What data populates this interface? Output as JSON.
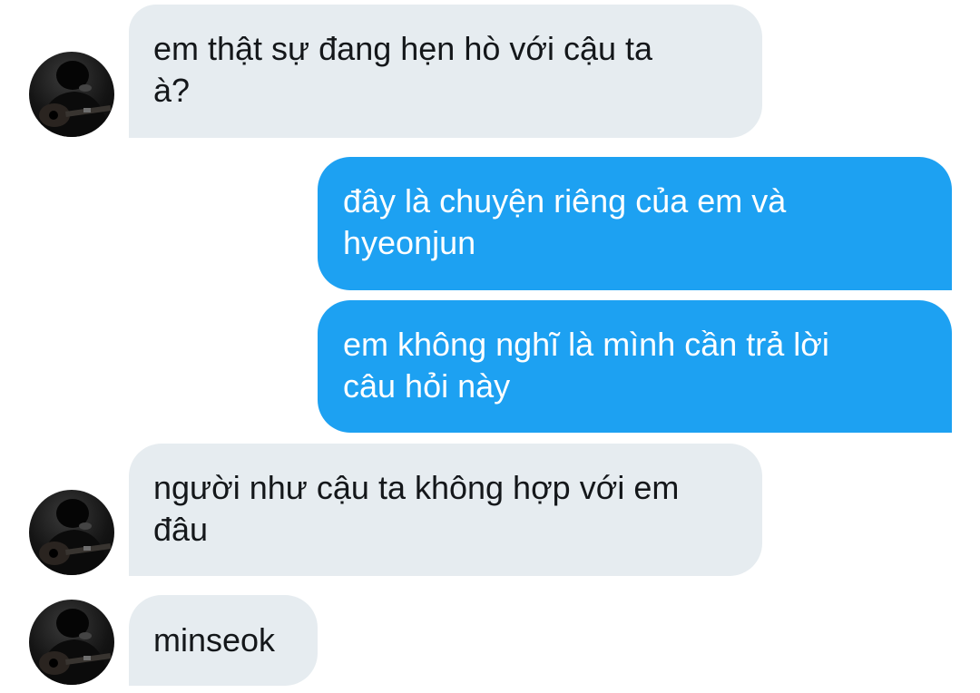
{
  "colors": {
    "incoming_bubble": "#e6ecf0",
    "outgoing_bubble": "#1da1f2",
    "incoming_text": "#14171a",
    "outgoing_text": "#ffffff"
  },
  "messages": [
    {
      "sender": "them",
      "text": "em thật sự đang hẹn hò với cậu ta\nà?",
      "avatar_icon": "profile-photo-guitar"
    },
    {
      "sender": "me",
      "text": "đây là chuyện riêng của em và\nhyeonjun"
    },
    {
      "sender": "me",
      "text": "em không nghĩ là mình cần trả lời\ncâu hỏi này"
    },
    {
      "sender": "them",
      "text": "người như cậu ta không hợp với em\nđâu",
      "avatar_icon": "profile-photo-guitar"
    },
    {
      "sender": "them",
      "text": "minseok",
      "avatar_icon": "profile-photo-guitar"
    }
  ]
}
